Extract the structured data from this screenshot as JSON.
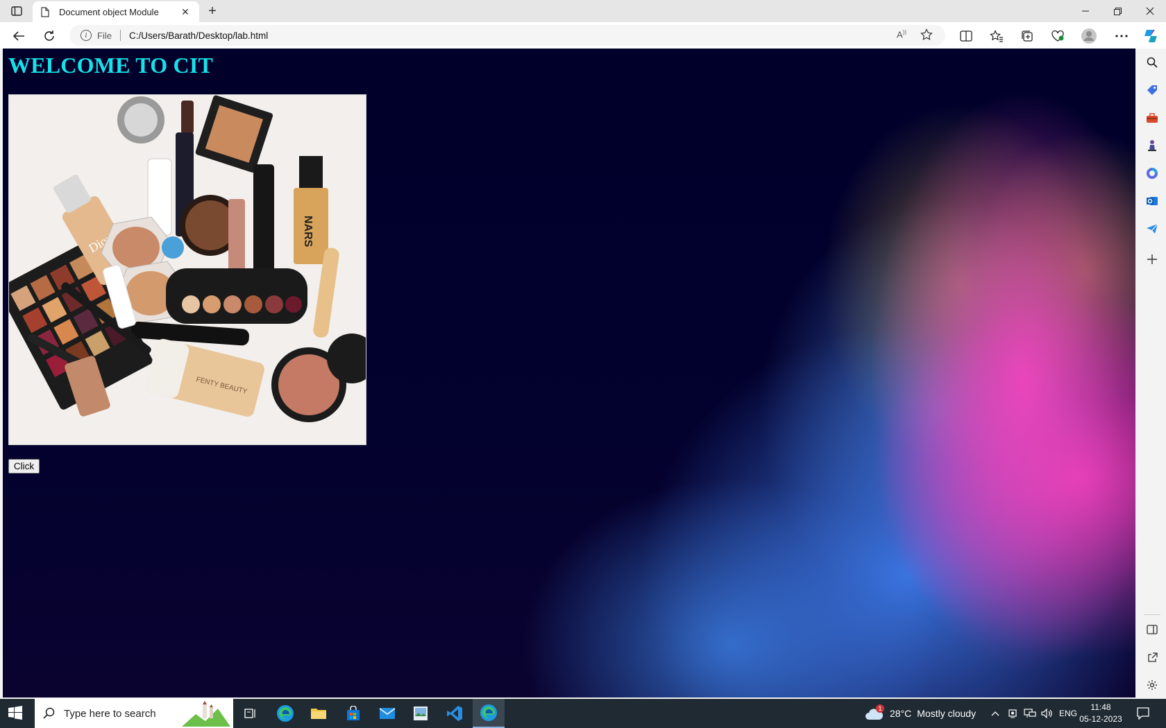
{
  "browser": {
    "tab": {
      "title": "Document object Module"
    },
    "omnibox": {
      "scheme": "File",
      "url": "C:/Users/Barath/Desktop/lab.html"
    }
  },
  "page": {
    "heading": "WELCOME TO CIT",
    "image_description_alt": "",
    "button_label": "Click",
    "colors": {
      "heading": "#14e4ea",
      "background": "#00002a"
    }
  },
  "taskbar": {
    "search_placeholder": "Type here to search",
    "weather": {
      "temp": "28°C",
      "condition": "Mostly cloudy",
      "badge": "1"
    },
    "language": "ENG",
    "time": "11:48",
    "date": "05-12-2023"
  }
}
